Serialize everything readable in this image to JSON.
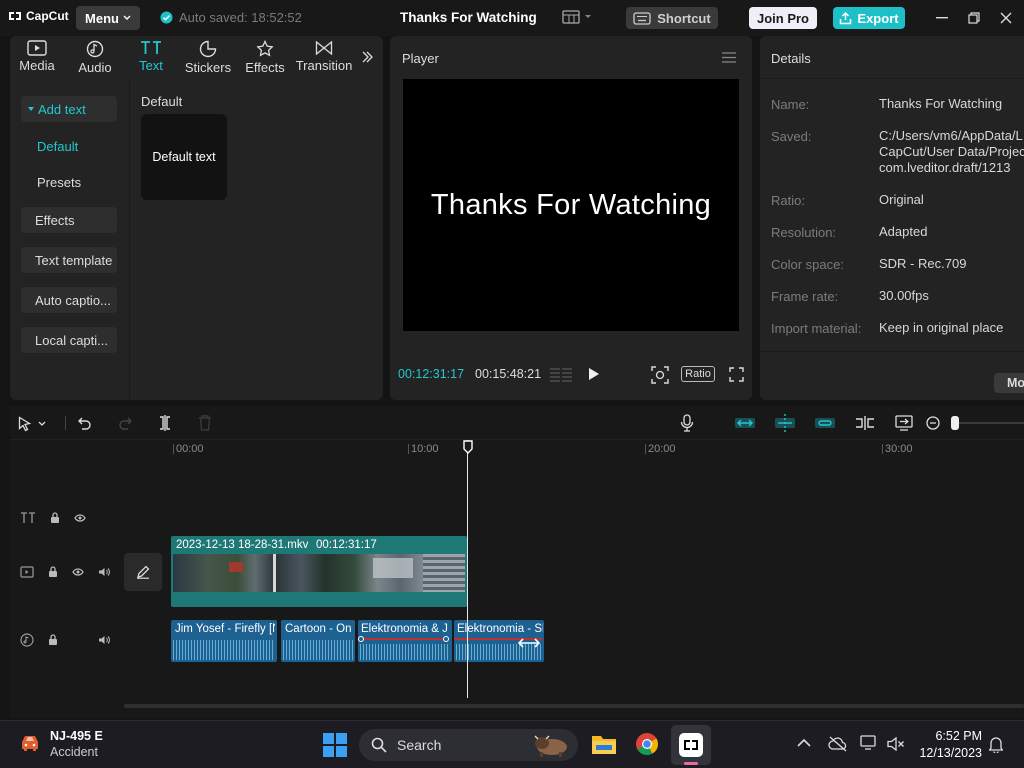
{
  "titlebar": {
    "logo_text": "CapCut",
    "menu_label": "Menu",
    "autosave": "Auto saved: 18:52:52",
    "doc_title": "Thanks For Watching",
    "shortcut_label": "Shortcut",
    "joinpro_label": "Join Pro",
    "export_label": "Export"
  },
  "toptabs": [
    {
      "label": "Media",
      "icon": "media-icon"
    },
    {
      "label": "Audio",
      "icon": "audio-icon"
    },
    {
      "label": "Text",
      "icon": "text-icon",
      "active": true
    },
    {
      "label": "Stickers",
      "icon": "stickers-icon"
    },
    {
      "label": "Effects",
      "icon": "effects-icon"
    },
    {
      "label": "Transition",
      "icon": "transition-icon"
    }
  ],
  "sidenav": {
    "add_text": "Add text",
    "default": "Default",
    "presets": "Presets",
    "effects": "Effects",
    "text_template": "Text template",
    "auto_captions": "Auto captio...",
    "local_captions": "Local capti..."
  },
  "text_panel": {
    "section": "Default",
    "card_label": "Default text"
  },
  "player": {
    "title": "Player",
    "screen_text": "Thanks For Watching",
    "current_time": "00:12:31:17",
    "total_time": "00:15:48:21",
    "ratio_label": "Ratio"
  },
  "details": {
    "title": "Details",
    "rows": [
      {
        "label": "Name:",
        "value": "Thanks For Watching"
      },
      {
        "label": "Saved:",
        "value": "C:/Users/vm6/AppData/L\nCapCut/User Data/Projec\ncom.lveditor.draft/1213"
      },
      {
        "label": "Ratio:",
        "value": "Original"
      },
      {
        "label": "Resolution:",
        "value": "Adapted"
      },
      {
        "label": "Color space:",
        "value": "SDR - Rec.709"
      },
      {
        "label": "Frame rate:",
        "value": "30.00fps"
      },
      {
        "label": "Import material:",
        "value": "Keep in original place"
      }
    ],
    "modify_label": "Mo"
  },
  "timeline": {
    "ruler": [
      "00:00",
      "10:00",
      "20:00",
      "30:00"
    ],
    "video_clip": {
      "name": "2023-12-13 18-28-31.mkv",
      "duration": "00:12:31:17"
    },
    "audio_clips": [
      "Jim Yosef - Firefly [N",
      "Cartoon - On",
      "Elektronomia & J",
      "Elektronomia - Sk"
    ]
  },
  "taskbar": {
    "weather_title": "NJ-495 E",
    "weather_sub": "Accident",
    "search_label": "Search",
    "time": "6:52 PM",
    "date": "12/13/2023"
  },
  "colors": {
    "accent": "#1ec0c8",
    "playhead": "#ffffff",
    "video_clip": "#1e7876",
    "audio_clip": "#1d6191"
  }
}
